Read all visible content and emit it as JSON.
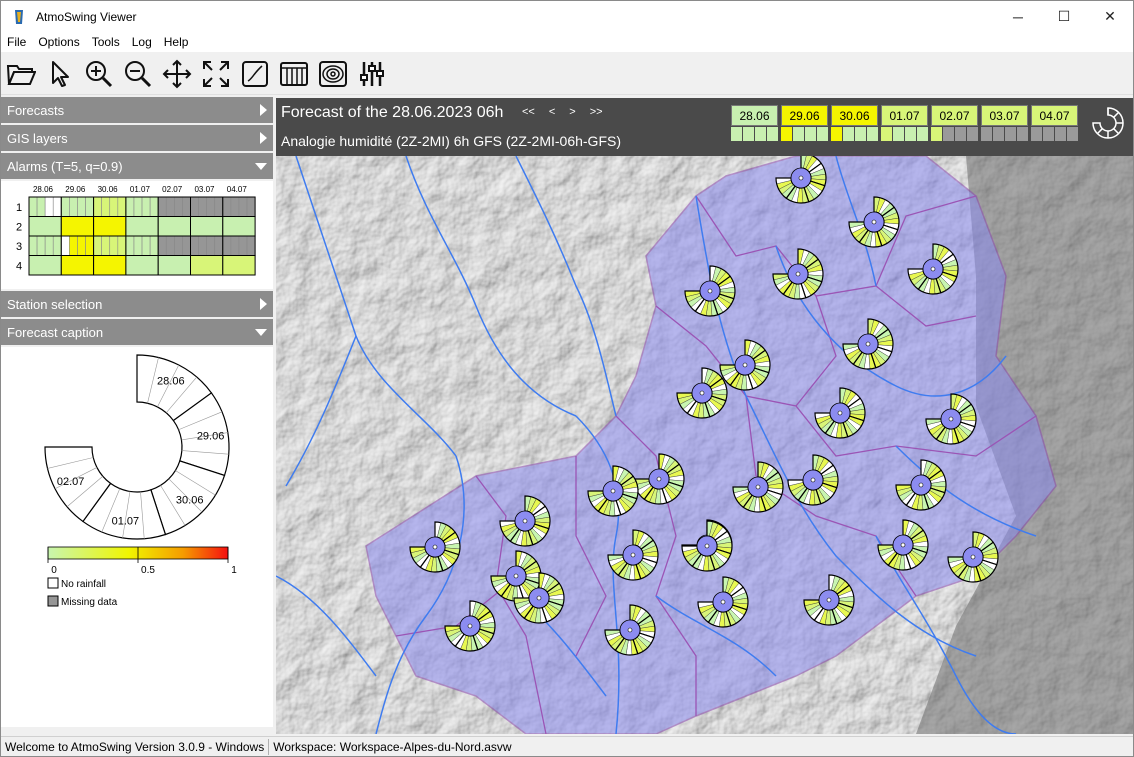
{
  "window": {
    "title": "AtmoSwing Viewer",
    "minimize": "─",
    "maximize": "☐",
    "close": "✕"
  },
  "menu": [
    "File",
    "Options",
    "Tools",
    "Log",
    "Help"
  ],
  "toolbar": [
    "open-folder-icon",
    "select-arrow-icon",
    "zoom-in-icon",
    "zoom-out-icon",
    "pan-icon",
    "full-extent-icon",
    "sidebar-icon",
    "table-icon",
    "contour-icon",
    "sliders-icon"
  ],
  "panel": {
    "forecasts": "Forecasts",
    "gis_layers": "GIS layers",
    "alarms": "Alarms (T=5, q=0.9)",
    "station_selection": "Station selection",
    "forecast_caption": "Forecast caption"
  },
  "alarms_grid": {
    "dates": [
      "28.06",
      "29.06",
      "30.06",
      "01.07",
      "02.07",
      "03.07",
      "04.07"
    ],
    "rows": [
      "1",
      "2",
      "3",
      "4"
    ],
    "colors": {
      "light_green": "#c8f0b0",
      "green_yellow": "#d8f578",
      "yellow": "#f5f500",
      "white": "#ffffff",
      "grey": "#969696"
    }
  },
  "caption": {
    "days": [
      "28.06",
      "29.06",
      "30.06",
      "01.07",
      "02.07"
    ],
    "scale_ticks": [
      "0",
      "0.5",
      "1"
    ],
    "legend": {
      "no_rainfall": "No rainfall",
      "missing_data": "Missing data"
    }
  },
  "map": {
    "title": "Forecast of the 28.06.2023 06h",
    "subtitle": "Analogie humidité (2Z-2MI) 6h GFS (2Z-2MI-06h-GFS)",
    "nav": [
      "<<",
      "<",
      ">",
      ">>"
    ],
    "dates": [
      {
        "label": "28.06",
        "color": "#c8f0b0"
      },
      {
        "label": "29.06",
        "color": "#f5f500"
      },
      {
        "label": "30.06",
        "color": "#f5f500"
      },
      {
        "label": "01.07",
        "color": "#d8f578"
      },
      {
        "label": "02.07",
        "color": "#d8f578"
      },
      {
        "label": "03.07",
        "color": "#d8f578"
      },
      {
        "label": "04.07",
        "color": "#d8f578"
      }
    ]
  },
  "status": {
    "welcome": "Welcome to AtmoSwing Version 3.0.9 - Windows",
    "workspace": "Workspace: Workspace-Alpes-du-Nord.asvw"
  }
}
